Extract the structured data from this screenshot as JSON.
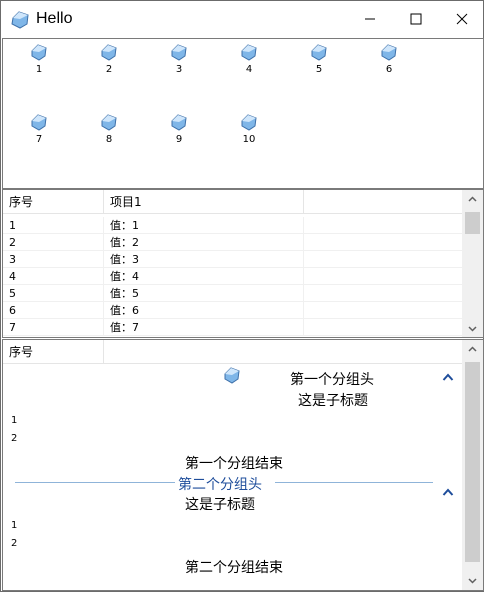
{
  "window": {
    "title": "Hello"
  },
  "icons": [
    "1",
    "2",
    "3",
    "4",
    "5",
    "6",
    "7",
    "8",
    "9",
    "10"
  ],
  "list": {
    "columns": [
      "序号",
      "项目1"
    ],
    "rows": [
      [
        "1",
        "值：1"
      ],
      [
        "2",
        "值：2"
      ],
      [
        "3",
        "值：3"
      ],
      [
        "4",
        "值：4"
      ],
      [
        "5",
        "值：5"
      ],
      [
        "6",
        "值：6"
      ],
      [
        "7",
        "值：7"
      ]
    ]
  },
  "groups": {
    "column": "序号",
    "group1": {
      "header": "第一个分组头",
      "subtitle": "这是子标题",
      "items": [
        "1",
        "2"
      ],
      "footer": "第一个分组结束"
    },
    "group2": {
      "header": "第二个分组头",
      "subtitle": "这是子标题",
      "items": [
        "1",
        "2"
      ],
      "footer": "第二个分组结束"
    }
  },
  "colors": {
    "accent": "#1e4d9b",
    "group_line": "#8fb4d9"
  }
}
